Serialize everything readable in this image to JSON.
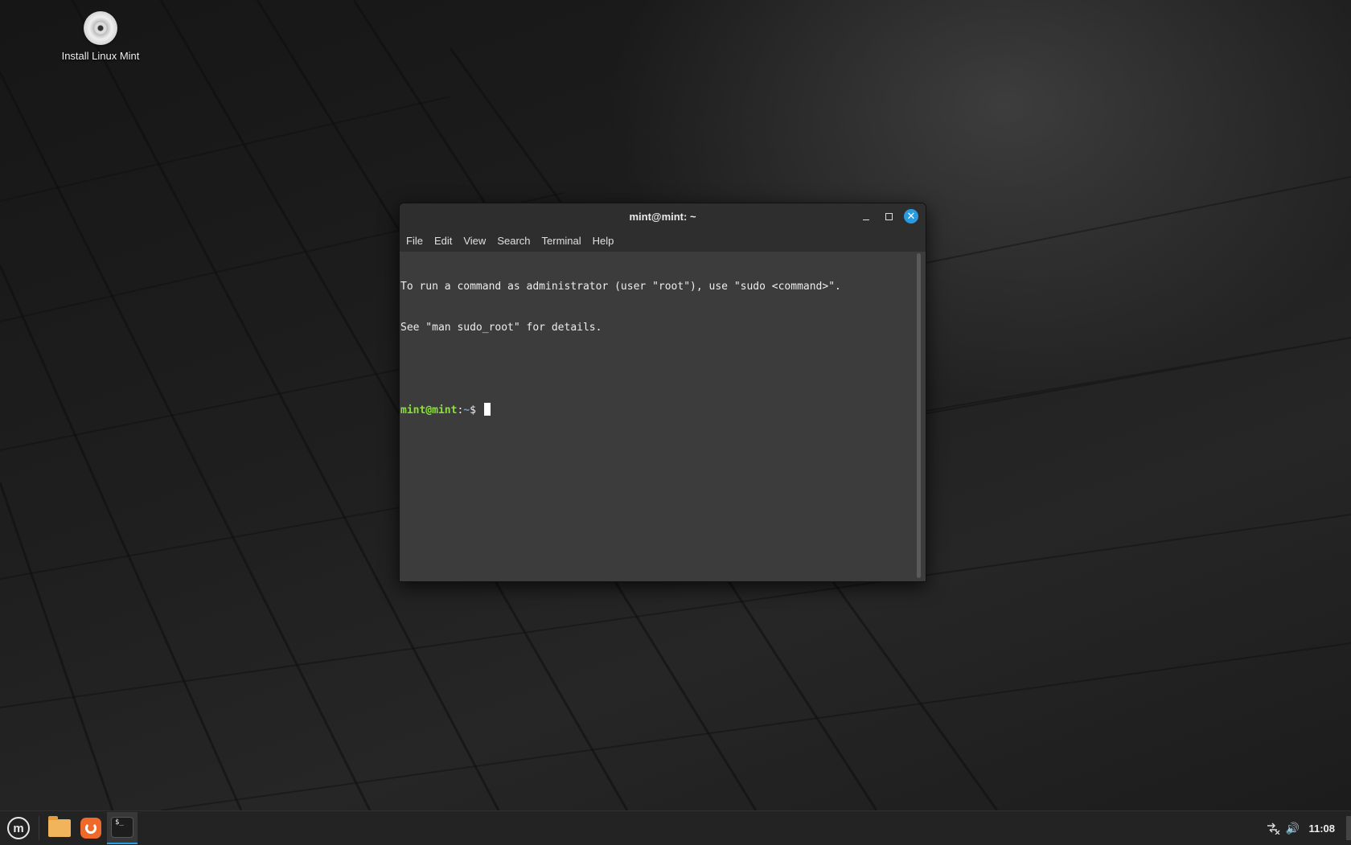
{
  "desktop": {
    "icons": [
      {
        "label": "Install Linux Mint",
        "icon": "disc-icon"
      }
    ]
  },
  "terminal_window": {
    "title": "mint@mint: ~",
    "menu": [
      "File",
      "Edit",
      "View",
      "Search",
      "Terminal",
      "Help"
    ],
    "lines": [
      "To run a command as administrator (user \"root\"), use \"sudo <command>\".",
      "See \"man sudo_root\" for details."
    ],
    "prompt": {
      "user_host": "mint@mint",
      "separator": ":",
      "path": "~",
      "symbol": "$ "
    },
    "close_glyph": "✕"
  },
  "taskbar": {
    "menu_glyph": "m",
    "terminal_icon_text": "$_",
    "launchers": [
      "menu-icon",
      "files-icon",
      "firefox-icon",
      "terminal-icon"
    ],
    "tray": {
      "network_icon": "network-disconnected-icon",
      "volume_icon": "volume-icon",
      "volume_glyph": "🔊",
      "clock": "11:08"
    }
  },
  "colors": {
    "accent": "#2a9be0",
    "prompt_user": "#8ae234",
    "prompt_path": "#729fcf",
    "terminal_bg": "#3c3c3c"
  }
}
